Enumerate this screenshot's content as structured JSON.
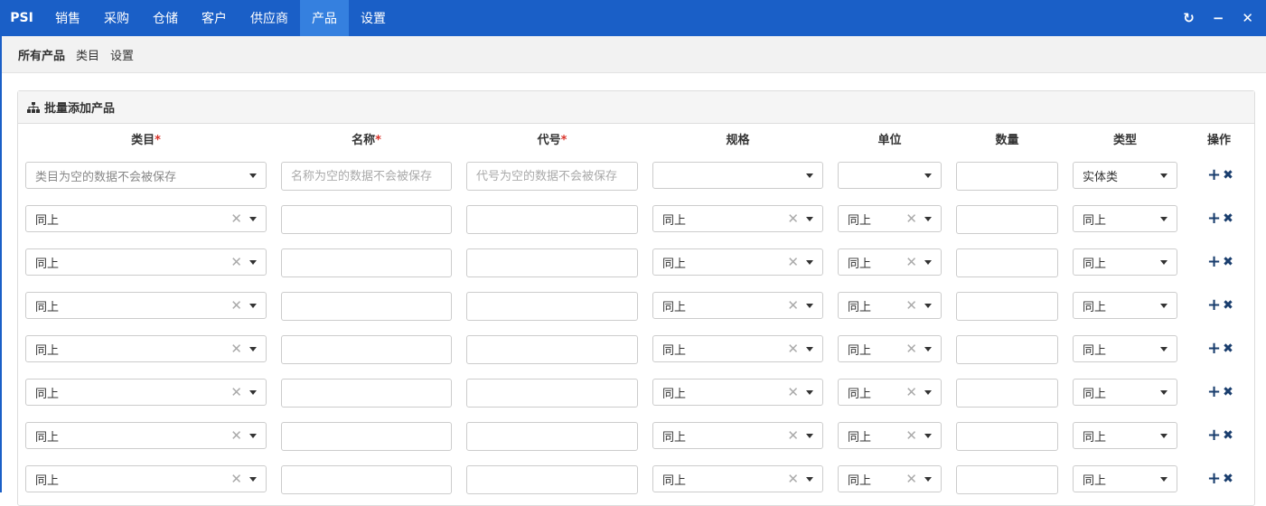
{
  "app": {
    "brand": "PSI"
  },
  "nav": {
    "items": [
      {
        "label": "销售"
      },
      {
        "label": "采购"
      },
      {
        "label": "仓储"
      },
      {
        "label": "客户"
      },
      {
        "label": "供应商"
      },
      {
        "label": "产品",
        "active": true
      },
      {
        "label": "设置"
      }
    ]
  },
  "window_controls": {
    "refresh": "↻",
    "minimize": "−",
    "close": "✕"
  },
  "subnav": {
    "items": [
      {
        "label": "所有产品",
        "active": true
      },
      {
        "label": "类目"
      },
      {
        "label": "设置"
      }
    ]
  },
  "panel": {
    "title": "批量添加产品"
  },
  "table": {
    "headers": {
      "category": "类目",
      "name": "名称",
      "code": "代号",
      "spec": "规格",
      "unit": "单位",
      "quantity": "数量",
      "type": "类型",
      "actions": "操作",
      "required_mark": "*"
    },
    "first_row": {
      "category_placeholder": "类目为空的数据不会被保存",
      "name_placeholder": "名称为空的数据不会被保存",
      "code_placeholder": "代号为空的数据不会被保存",
      "spec": "",
      "unit": "",
      "type": "实体类"
    },
    "same_label": "同上",
    "extra_row_count": 7
  },
  "icons": {
    "clear": "✕",
    "add": "+",
    "remove": "✖",
    "sitemap": "sitemap-icon"
  },
  "colors": {
    "topbar": "#1a5fc7",
    "active_tab": "#3580df",
    "required": "#d9332a",
    "action_icons": "#1a3e6e"
  }
}
